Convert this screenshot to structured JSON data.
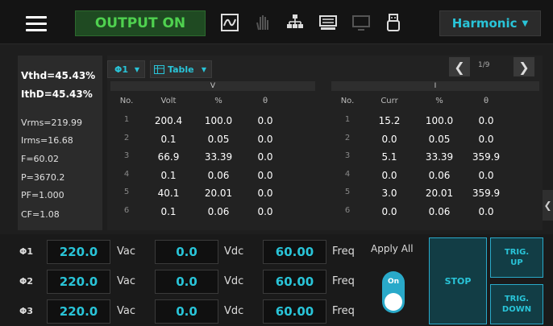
{
  "header": {
    "output_label": "OUTPUT ON",
    "mode_label": "Harmonic",
    "icons": [
      "menu-icon",
      "waveform-icon",
      "hand-icon",
      "network-icon",
      "keyboard-icon",
      "monitor-icon",
      "usb-icon"
    ]
  },
  "summary": {
    "vthd": "Vthd=45.43%",
    "ithd": "IthD=45.43%",
    "vrms": "Vrms=219.99",
    "irms": "Irms=16.68",
    "freq": "F=60.02",
    "power": "P=3670.2",
    "pf": "PF=1.000",
    "cf": "CF=1.08"
  },
  "controls": {
    "phase_select": "Φ1",
    "view_select": "Table",
    "page": "1/9"
  },
  "table": {
    "v_group": "V",
    "i_group": "I",
    "v_cols": [
      "No.",
      "Volt",
      "%",
      "θ"
    ],
    "i_cols": [
      "No.",
      "Curr",
      "%",
      "θ"
    ],
    "rows": [
      {
        "no": "1",
        "volt": "200.4",
        "vpct": "100.0",
        "vth": "0.0",
        "ino": "1",
        "curr": "15.2",
        "ipct": "100.0",
        "ith": "0.0"
      },
      {
        "no": "2",
        "volt": "0.1",
        "vpct": "0.05",
        "vth": "0.0",
        "ino": "2",
        "curr": "0.0",
        "ipct": "0.05",
        "ith": "0.0"
      },
      {
        "no": "3",
        "volt": "66.9",
        "vpct": "33.39",
        "vth": "0.0",
        "ino": "3",
        "curr": "5.1",
        "ipct": "33.39",
        "ith": "359.9"
      },
      {
        "no": "4",
        "volt": "0.1",
        "vpct": "0.06",
        "vth": "0.0",
        "ino": "4",
        "curr": "0.0",
        "ipct": "0.06",
        "ith": "0.0"
      },
      {
        "no": "5",
        "volt": "40.1",
        "vpct": "20.01",
        "vth": "0.0",
        "ino": "5",
        "curr": "3.0",
        "ipct": "20.01",
        "ith": "359.9"
      },
      {
        "no": "6",
        "volt": "0.1",
        "vpct": "0.06",
        "vth": "0.0",
        "ino": "6",
        "curr": "0.0",
        "ipct": "0.06",
        "ith": "0.0"
      }
    ]
  },
  "phases": [
    {
      "label": "Φ1",
      "vac": "220.0",
      "vac_unit": "Vac",
      "vdc": "0.0",
      "vdc_unit": "Vdc",
      "freq": "60.00",
      "freq_unit": "Freq"
    },
    {
      "label": "Φ2",
      "vac": "220.0",
      "vac_unit": "Vac",
      "vdc": "0.0",
      "vdc_unit": "Vdc",
      "freq": "60.00",
      "freq_unit": "Freq"
    },
    {
      "label": "Φ3",
      "vac": "220.0",
      "vac_unit": "Vac",
      "vdc": "0.0",
      "vdc_unit": "Vdc",
      "freq": "60.00",
      "freq_unit": "Freq"
    }
  ],
  "apply_all": {
    "label": "Apply All",
    "state": "On"
  },
  "buttons": {
    "stop": "STOP",
    "trig_up": "TRIG. UP",
    "trig_down": "TRIG. DOWN"
  },
  "colors": {
    "accent": "#29c4d8",
    "output_green": "#4fd14f",
    "toggle": "#29a9c9"
  }
}
